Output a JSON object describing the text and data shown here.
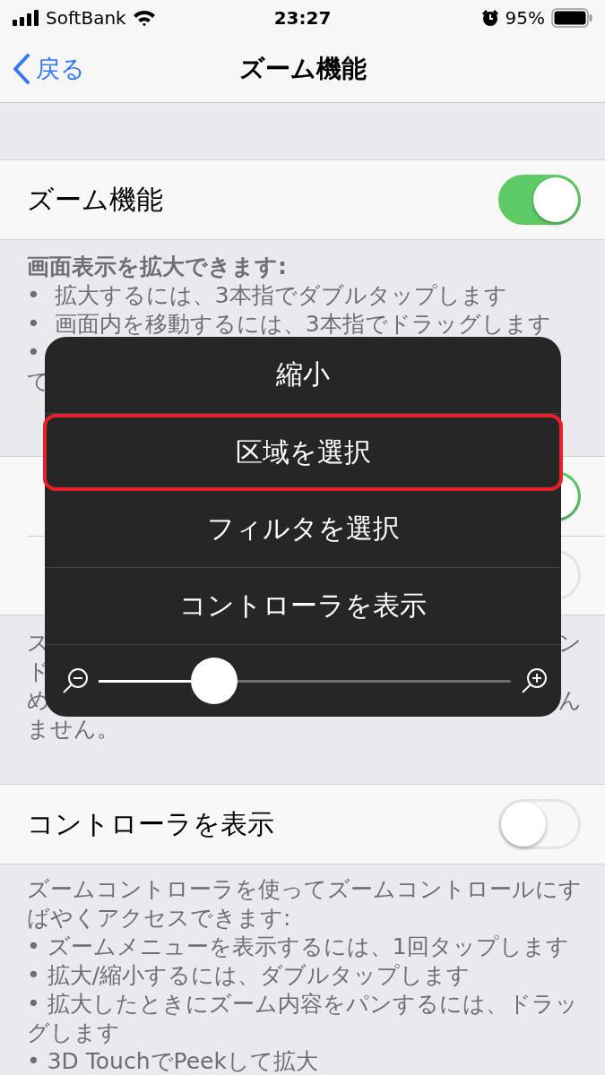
{
  "status_bar": {
    "carrier": "SoftBank",
    "time": "23:27",
    "battery": "95%"
  },
  "nav": {
    "back": "戻る",
    "title": "ズーム機能"
  },
  "groups": [
    {
      "rows": [
        {
          "label": "ズーム機能",
          "on": true
        }
      ],
      "footer": [
        {
          "kind": "heading",
          "text": "画面表示を拡大できます:"
        },
        {
          "kind": "line",
          "text": "•  拡大するには、3本指でダブルタップします"
        },
        {
          "kind": "line",
          "text": "•  画面内を移動するには、3本指でドラッグします"
        },
        {
          "kind": "line",
          "text": "•"
        },
        {
          "kind": "line",
          "text": "て"
        }
      ]
    },
    {
      "rows": [
        {
          "on": true
        },
        {
          "on": false
        }
      ],
      "footer": [
        {
          "kind": "split",
          "left": "ス",
          "right": "ン"
        },
        {
          "kind": "split",
          "left": "ド"
        },
        {
          "kind": "split",
          "left": "め",
          "right": "ん"
        },
        {
          "kind": "line",
          "text": "ません。"
        }
      ]
    },
    {
      "rows": [
        {
          "label": "コントローラを表示",
          "on": false
        }
      ],
      "footer": [
        {
          "kind": "line",
          "text": "ズームコントローラを使ってズームコントロールにす"
        },
        {
          "kind": "line",
          "text": "ばやくアクセスできます:"
        },
        {
          "kind": "line",
          "text": "• ズームメニューを表示するには、1回タップします"
        },
        {
          "kind": "line",
          "text": "• 拡大/縮小するには、ダブルタップします"
        },
        {
          "kind": "line",
          "text": "• 拡大したときにズーム内容をパンするには、ドラッ"
        },
        {
          "kind": "line",
          "text": "グします"
        },
        {
          "kind": "line",
          "text": "• 3D TouchでPeekして拡大"
        }
      ]
    }
  ],
  "zoom_menu": {
    "items": [
      {
        "label": "縮小",
        "selected": false
      },
      {
        "label": "区域を選択",
        "selected": true
      },
      {
        "label": "フィルタを選択",
        "selected": false
      },
      {
        "label": "コントローラを表示",
        "selected": false
      }
    ],
    "slider": {
      "level": 0.28
    }
  }
}
